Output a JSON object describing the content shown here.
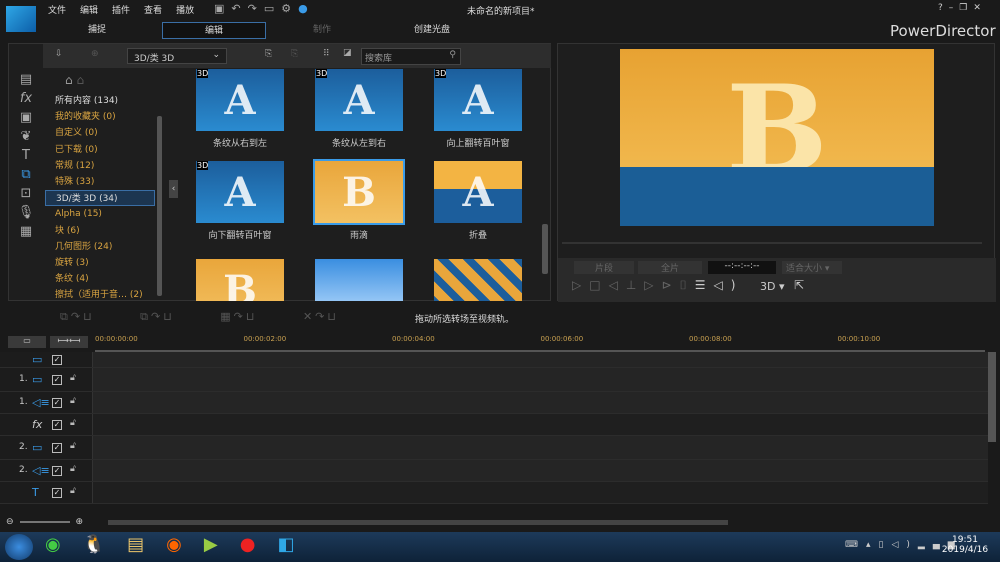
{
  "app": {
    "title": "未命名的新项目*",
    "brand": "PowerDirector",
    "help": "?"
  },
  "menu": [
    "文件",
    "编辑",
    "插件",
    "查看",
    "播放"
  ],
  "tabs": [
    {
      "label": "捕捉"
    },
    {
      "label": "编辑",
      "active": true
    },
    {
      "label": "制作",
      "disabled": true
    },
    {
      "label": "创建光盘"
    }
  ],
  "library": {
    "dropdown": "3D/类 3D",
    "search_placeholder": "搜索库",
    "categories": [
      {
        "label": "所有内容 (134)",
        "white": true
      },
      {
        "label": "我的收藏夹 (0)"
      },
      {
        "label": "自定义 (0)"
      },
      {
        "label": "已下载 (0)"
      },
      {
        "label": "常规 (12)"
      },
      {
        "label": "特殊 (33)"
      },
      {
        "label": "3D/类 3D (34)",
        "selected": true,
        "white": true
      },
      {
        "label": "Alpha (15)"
      },
      {
        "label": "块 (6)"
      },
      {
        "label": "几何图形 (24)"
      },
      {
        "label": "旋转 (3)"
      },
      {
        "label": "条纹 (4)"
      },
      {
        "label": "擦拭（适用于音…  (2)"
      }
    ],
    "thumbnails": [
      {
        "label": "条纹从右到左",
        "letter": "A",
        "style": "blue",
        "badge": "3D"
      },
      {
        "label": "条纹从左到右",
        "letter": "A",
        "style": "blue",
        "badge": "3D"
      },
      {
        "label": "向上翻转百叶窗",
        "letter": "A",
        "style": "blue",
        "badge": "3D"
      },
      {
        "label": "向下翻转百叶窗",
        "letter": "A",
        "style": "blue",
        "badge": "3D"
      },
      {
        "label": "雨滴",
        "letter": "B",
        "style": "orange",
        "selected": true
      },
      {
        "label": "折叠",
        "letter": "A",
        "style": "mixed"
      },
      {
        "label": "",
        "letter": "B",
        "style": "orange"
      },
      {
        "label": "",
        "letter": "",
        "style": "sky"
      },
      {
        "label": "",
        "letter": "",
        "style": "shatter"
      }
    ]
  },
  "preview": {
    "letter": "B",
    "clip_button": "片段",
    "movie_button": "全片",
    "timecode": "--:--:--:--",
    "fit": "适合大小",
    "mode_3d": "3D"
  },
  "transition_toolbar": {
    "hint": "拖动所选转场至视频轨。"
  },
  "timeline": {
    "ticks": [
      "00:00:00:00",
      "00:00:02:00",
      "00:00:04:00",
      "00:00:06:00",
      "00:00:08:00",
      "00:00:10:00"
    ],
    "tracks": [
      {
        "num": "",
        "icon": "video"
      },
      {
        "num": "1.",
        "icon": "video"
      },
      {
        "num": "1.",
        "icon": "audio"
      },
      {
        "num": "",
        "icon": "fx"
      },
      {
        "num": "2.",
        "icon": "video"
      },
      {
        "num": "2.",
        "icon": "audio"
      },
      {
        "num": "",
        "icon": "title"
      }
    ]
  },
  "taskbar": {
    "time": "19:51",
    "date": "2019/4/16"
  },
  "colors": {
    "accent": "#3a6ea5",
    "category": "#d9a441",
    "preview_bg": "#f0b43c"
  }
}
